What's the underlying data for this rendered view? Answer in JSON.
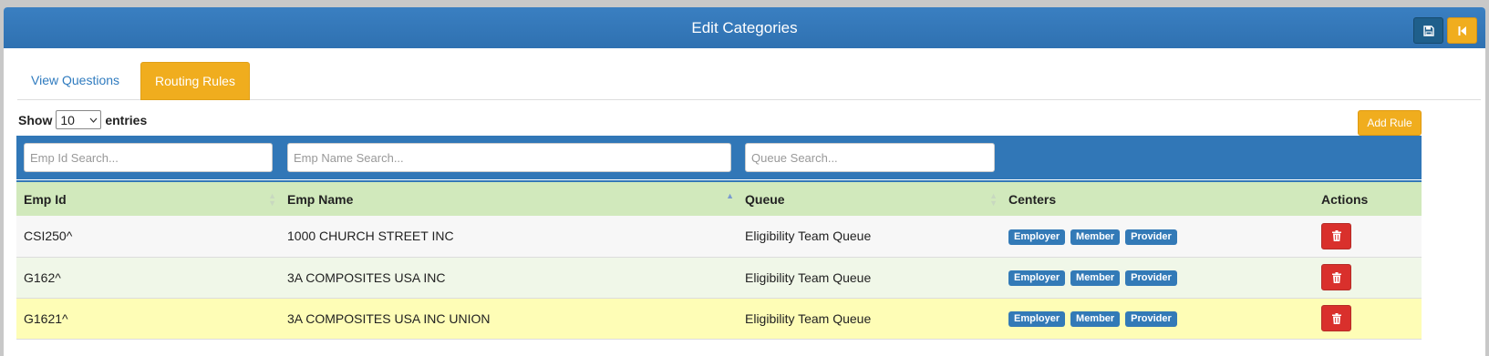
{
  "header": {
    "title": "Edit Categories",
    "save_icon": "save-icon",
    "back_icon": "step-backward-icon"
  },
  "tabs": [
    {
      "label": "View Questions",
      "active": false
    },
    {
      "label": "Routing Rules",
      "active": true
    }
  ],
  "entries": {
    "prefix": "Show",
    "value": "10",
    "suffix": "entries"
  },
  "add_rule_label": "Add Rule",
  "search": {
    "emp_id_placeholder": "Emp Id Search...",
    "emp_name_placeholder": "Emp Name Search...",
    "queue_placeholder": "Queue Search..."
  },
  "table": {
    "columns": [
      "Emp Id",
      "Emp Name",
      "Queue",
      "Centers",
      "Actions"
    ],
    "sorted_column": "Emp Name",
    "rows": [
      {
        "emp_id": "CSI250^",
        "emp_name": "1000 CHURCH STREET INC",
        "queue": "Eligibility Team Queue",
        "centers": [
          "Employer",
          "Member",
          "Provider"
        ]
      },
      {
        "emp_id": "G162^",
        "emp_name": "3A COMPOSITES USA INC",
        "queue": "Eligibility Team Queue",
        "centers": [
          "Employer",
          "Member",
          "Provider"
        ]
      },
      {
        "emp_id": "G1621^",
        "emp_name": "3A COMPOSITES USA INC UNION",
        "queue": "Eligibility Team Queue",
        "centers": [
          "Employer",
          "Member",
          "Provider"
        ]
      }
    ]
  },
  "colors": {
    "header": "#3177b7",
    "accent": "#f0ad1e",
    "danger": "#d9302c",
    "table_header": "#d1e9bc",
    "highlight_row": "#fefdb6"
  }
}
